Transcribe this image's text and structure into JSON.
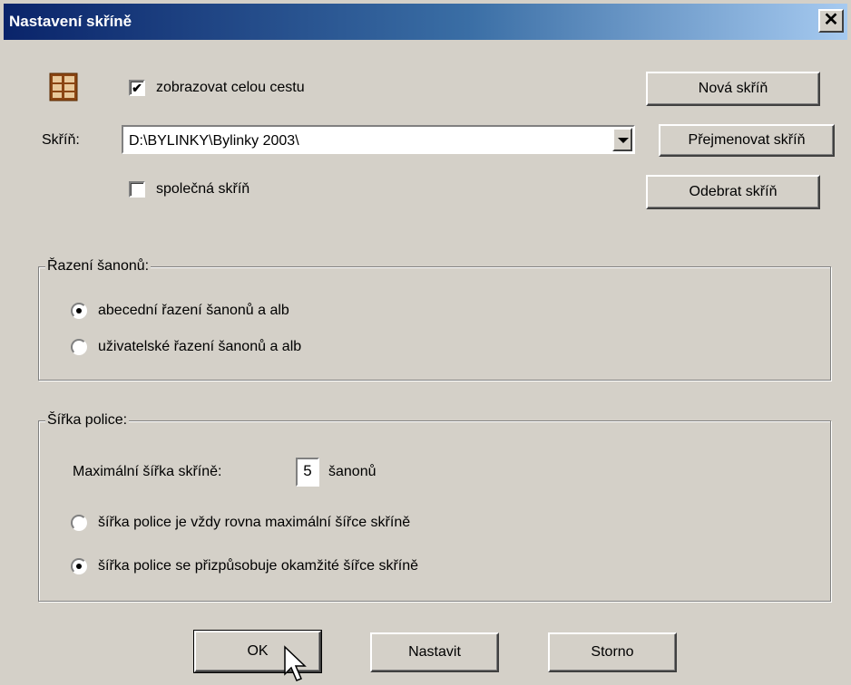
{
  "window": {
    "title": "Nastavení skříně",
    "close_glyph": "✕"
  },
  "cabinet": {
    "icon": "cabinet-icon",
    "show_full_path_label": "zobrazovat celou cestu",
    "show_full_path_checked": true,
    "skrin_label": "Skříň:",
    "path_value": "D:\\BYLINKY\\Bylinky 2003\\",
    "shared_label": "společná skříň",
    "shared_checked": false
  },
  "buttons": {
    "new": "Nová skříň",
    "rename": "Přejmenovat skříň",
    "remove": "Odebrat skříň",
    "ok": "OK",
    "apply": "Nastavit",
    "cancel": "Storno"
  },
  "sorting": {
    "legend": "Řazení šanonů:",
    "options": [
      {
        "label": "abecední řazení šanonů a alb",
        "selected": true
      },
      {
        "label": "uživatelské řazení šanonů a alb",
        "selected": false
      }
    ]
  },
  "shelf_width": {
    "legend": "Šířka police:",
    "max_label": "Maximální šířka skříně:",
    "max_value": "5",
    "unit": "šanonů",
    "options": [
      {
        "label": "šířka police je vždy rovna maximální šířce skříně",
        "selected": false
      },
      {
        "label": "šířka police se přizpůsobuje okamžité šířce skříně",
        "selected": true
      }
    ]
  },
  "colors": {
    "face": "#d4d0c8",
    "title_start": "#0a246a",
    "title_end": "#a6caf0"
  }
}
